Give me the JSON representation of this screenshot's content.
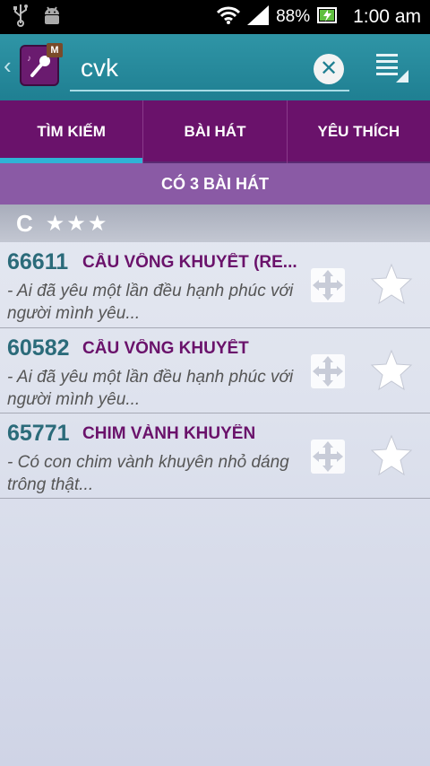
{
  "status_bar": {
    "icons_left": [
      "usb-icon",
      "android-debug-icon"
    ],
    "battery_percent": "88%",
    "time": "1:00 am"
  },
  "action_bar": {
    "app_icon_badge": "M",
    "search": {
      "value": "cvk",
      "placeholder": ""
    }
  },
  "tabs": [
    {
      "label": "TÌM KIẾM",
      "active": true
    },
    {
      "label": "BÀI HÁT",
      "active": false
    },
    {
      "label": "YÊU THÍCH",
      "active": false
    }
  ],
  "count_banner": "CÓ 3 BÀI HÁT",
  "section": {
    "letter": "C",
    "stars": "★★★"
  },
  "songs": [
    {
      "code": "66611",
      "title": "CẦU VỒNG KHUYẾT (RE...",
      "lyric": "- Ai đã yêu một lần đều hạnh phúc với người mình yêu..."
    },
    {
      "code": "60582",
      "title": "CẦU VỒNG KHUYẾT",
      "lyric": "- Ai đã yêu một lần đều hạnh phúc với người mình yêu..."
    },
    {
      "code": "65771",
      "title": "CHIM VÀNH KHUYÊN",
      "lyric": "- Có con chim vành khuyên nhỏ dáng trông thật..."
    }
  ],
  "colors": {
    "action_bar": "#1f7f92",
    "tab_bar": "#6a126b",
    "tab_indicator": "#2fb3d6",
    "banner": "#8a5aa5",
    "song_code": "#2b6b7a",
    "song_title": "#6a126b"
  }
}
